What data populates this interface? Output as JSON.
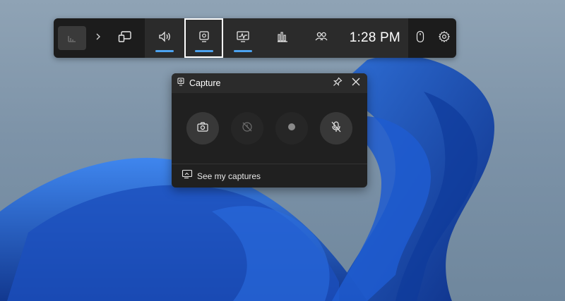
{
  "gamebar": {
    "time": "1:28 PM",
    "icons": {
      "home": "game-bar-home-icon",
      "expand": "chevron-right-icon",
      "widget_menu": "widget-menu-icon",
      "audio": "audio-icon",
      "capture": "capture-icon",
      "performance": "performance-icon",
      "resources": "resources-icon",
      "social": "social-icon",
      "mouse": "mouse-icon",
      "settings": "gear-icon"
    },
    "accent": "#4ca3f0"
  },
  "capture": {
    "title": "Capture",
    "footer_label": "See my captures",
    "buttons": [
      "screenshot-icon",
      "record-last-icon",
      "record-icon",
      "mic-off-icon"
    ]
  }
}
